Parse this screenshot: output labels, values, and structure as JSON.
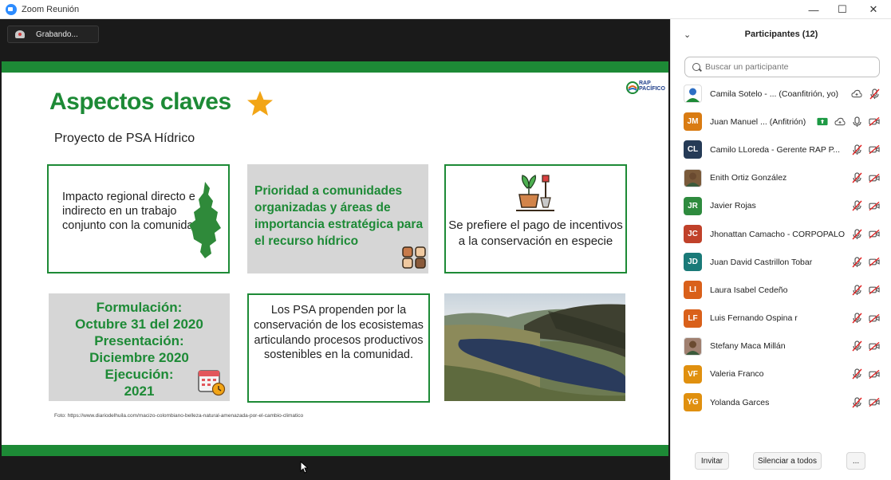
{
  "window": {
    "title": "Zoom Reunión",
    "controls": {
      "minimize": "—",
      "maximize": "☐",
      "close": "✕"
    }
  },
  "recording": {
    "label": "Grabando..."
  },
  "slide": {
    "logo_line1": "RAP",
    "logo_line2": "PACÍFICO",
    "title": "Aspectos claves",
    "subtitle": "Proyecto de PSA Hídrico",
    "card1": "Impacto regional directo e indirecto en un trabajo conjunto con la comunidad",
    "card2": "Prioridad a comunidades organizadas y áreas de importancia estratégica para el recurso hídrico",
    "card3": "Se prefiere el pago de incentivos a la conservación en especie",
    "card4": [
      "Formulación:",
      "Octubre 31 del 2020",
      "Presentación:",
      "Diciembre 2020",
      "Ejecución:",
      "2021"
    ],
    "card5": "Los PSA propenden por la conservación de los ecosistemas articulando procesos productivos sostenibles en la comunidad.",
    "photo_note": "Foto: https://www.diariodelhuila.com/macizo-colombiano-belleza-natural-amenazada-por-el-cambio-climatico",
    "colors": {
      "green": "#1d8a36",
      "star": "#f2a516"
    }
  },
  "panel": {
    "title": "Participantes (12)",
    "search_placeholder": "Buscar un participante",
    "participants": [
      {
        "initials": "",
        "name": "Camila Sotelo - ...  (Coanfitrión, yo)",
        "avatar_color": "#ffffff",
        "photo": true,
        "icons": [
          "cloud-icon",
          "mic-muted-icon"
        ]
      },
      {
        "initials": "JM",
        "name": "Juan Manuel ...  (Anfitrión)",
        "avatar_color": "#d97b12",
        "photo": false,
        "icons": [
          "share-screen-icon",
          "cloud-icon",
          "mic-icon",
          "video-off-icon"
        ]
      },
      {
        "initials": "CL",
        "name": "Camilo LLoreda - Gerente RAP P...",
        "avatar_color": "#253a56",
        "photo": false,
        "icons": [
          "mic-muted-icon",
          "video-off-icon"
        ]
      },
      {
        "initials": "",
        "name": "Enith Ortiz González",
        "avatar_color": "#7a5a3a",
        "photo": true,
        "icons": [
          "mic-muted-icon",
          "video-off-icon"
        ]
      },
      {
        "initials": "JR",
        "name": "Javier Rojas",
        "avatar_color": "#2e8b3e",
        "photo": false,
        "icons": [
          "mic-muted-icon",
          "video-off-icon"
        ]
      },
      {
        "initials": "JC",
        "name": "Jhonattan Camacho - CORPOPALO",
        "avatar_color": "#c0412a",
        "photo": false,
        "icons": [
          "mic-muted-icon",
          "video-off-icon"
        ]
      },
      {
        "initials": "JD",
        "name": "Juan David Castrillon Tobar",
        "avatar_color": "#1a7a78",
        "photo": false,
        "icons": [
          "mic-muted-icon",
          "video-off-icon"
        ]
      },
      {
        "initials": "LI",
        "name": "Laura Isabel Cedeño",
        "avatar_color": "#d9601a",
        "photo": false,
        "icons": [
          "mic-muted-icon",
          "video-off-icon"
        ]
      },
      {
        "initials": "LF",
        "name": "Luis Fernando Ospina r",
        "avatar_color": "#d9601a",
        "photo": false,
        "icons": [
          "mic-muted-icon",
          "video-off-icon"
        ]
      },
      {
        "initials": "",
        "name": "Stefany Maca Millán",
        "avatar_color": "#a08070",
        "photo": true,
        "icons": [
          "mic-muted-icon",
          "video-off-icon"
        ]
      },
      {
        "initials": "VF",
        "name": "Valeria Franco",
        "avatar_color": "#e0900f",
        "photo": false,
        "icons": [
          "mic-muted-icon",
          "video-off-icon"
        ]
      },
      {
        "initials": "YG",
        "name": "Yolanda Garces",
        "avatar_color": "#e0900f",
        "photo": false,
        "icons": [
          "mic-muted-icon",
          "video-off-icon"
        ]
      }
    ],
    "footer": {
      "invite": "Invitar",
      "mute_all": "Silenciar a todos",
      "more": "..."
    }
  }
}
